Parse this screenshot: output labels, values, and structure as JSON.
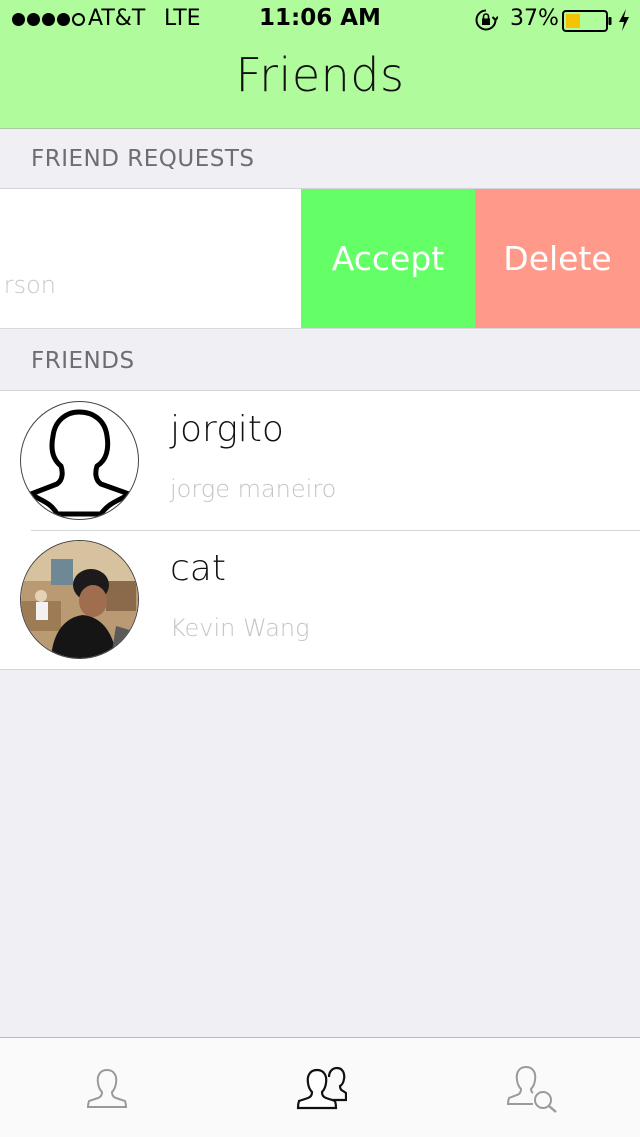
{
  "status_bar": {
    "carrier": "AT&T",
    "network": "LTE",
    "time": "11:06 AM",
    "battery_percent": "37%",
    "battery_level": 0.37,
    "battery_color": "#f5c400"
  },
  "nav": {
    "title": "Friends"
  },
  "colors": {
    "header_bg": "#b0fb9c",
    "accept": "#64ff66",
    "delete": "#ff9a8a"
  },
  "friend_requests": {
    "header": "FRIEND REQUESTS",
    "items": [
      {
        "subtitle_visible": "rson",
        "accept_label": "Accept",
        "delete_label": "Delete"
      }
    ]
  },
  "friends": {
    "header": "FRIENDS",
    "items": [
      {
        "username": "jorgito",
        "full_name": "jorge maneiro",
        "avatar": "default-person-icon"
      },
      {
        "username": "cat",
        "full_name": "Kevin Wang",
        "avatar": "photo"
      }
    ]
  },
  "tab_bar": {
    "tabs": [
      {
        "icon": "person-icon",
        "active": false
      },
      {
        "icon": "people-icon",
        "active": true
      },
      {
        "icon": "person-search-icon",
        "active": false
      }
    ]
  }
}
